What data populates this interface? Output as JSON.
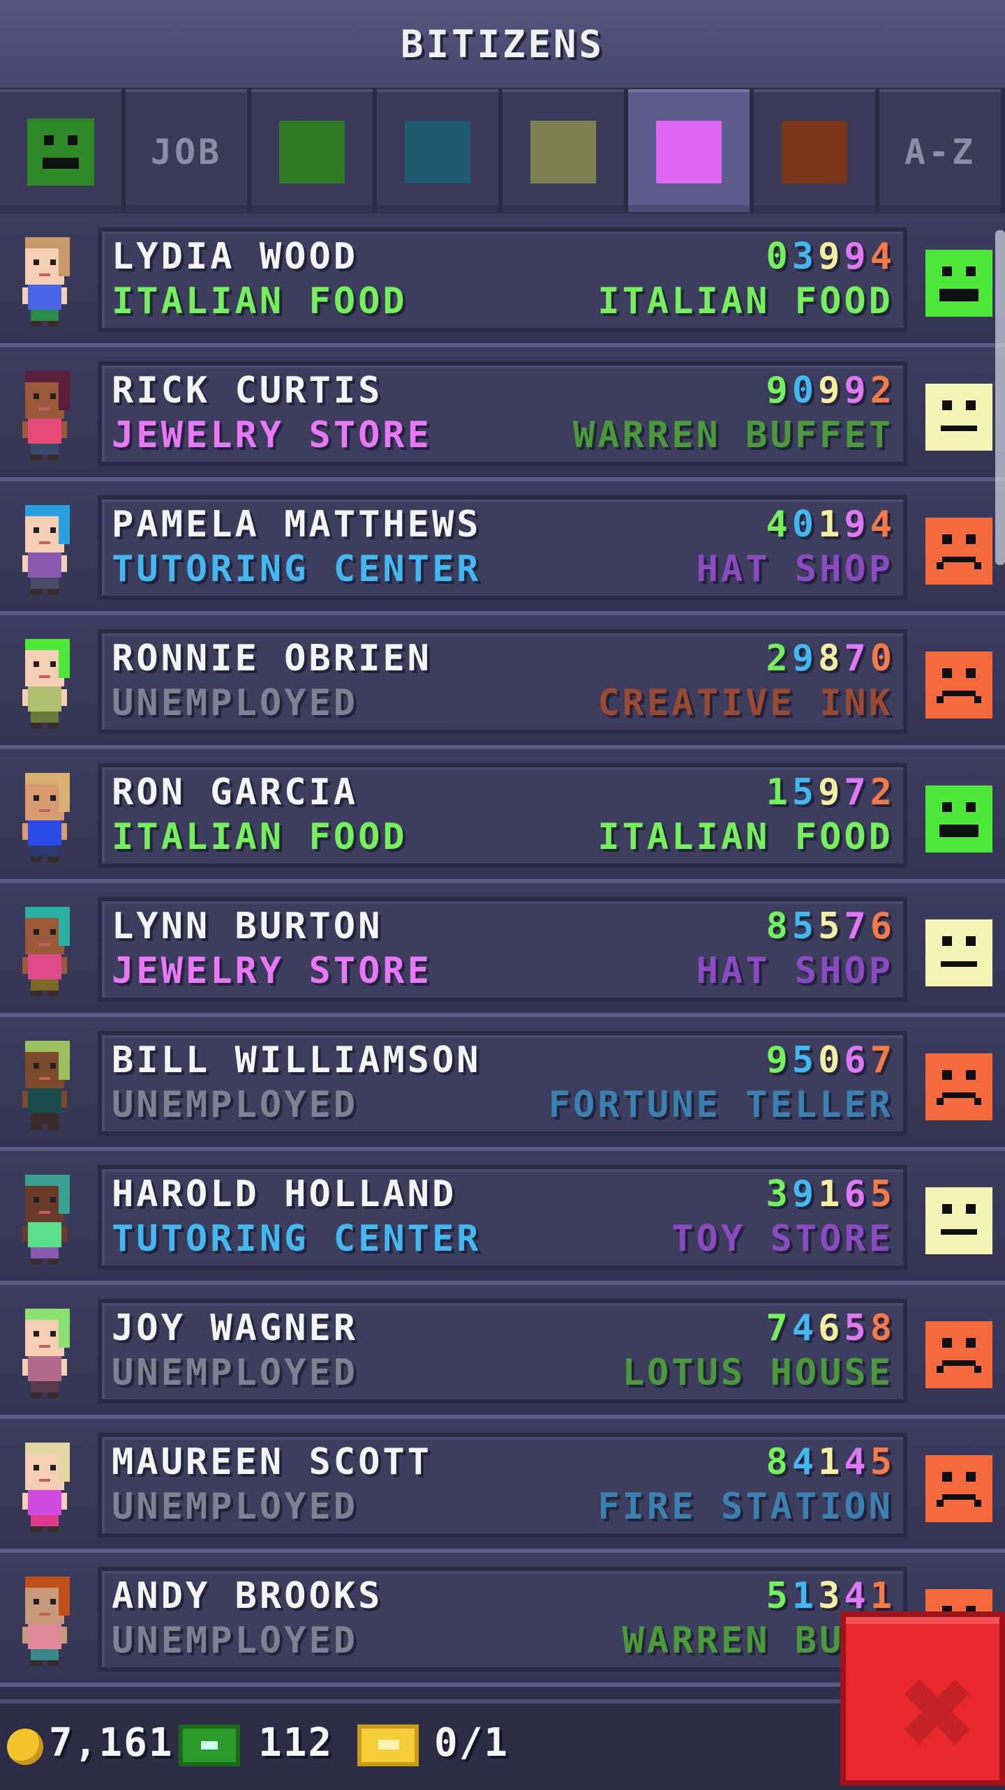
{
  "header": {
    "title": "BITIZENS"
  },
  "tabs": [
    {
      "type": "smiley",
      "color": "#2e8a26",
      "active": false
    },
    {
      "type": "text",
      "label": "JOB",
      "active": false
    },
    {
      "type": "swatch",
      "color": "#2c7a22",
      "active": false
    },
    {
      "type": "swatch",
      "color": "#1f5a70",
      "active": false
    },
    {
      "type": "swatch",
      "color": "#7a8050",
      "active": false
    },
    {
      "type": "swatch",
      "color": "#df66f3",
      "active": true
    },
    {
      "type": "swatch",
      "color": "#7a3618",
      "active": false
    },
    {
      "type": "text",
      "label": "A-Z",
      "active": false
    }
  ],
  "bitizens": [
    {
      "name": "LYDIA WOOD",
      "digits": "03994",
      "job": "ITALIAN FOOD",
      "job_color": "#74f05a",
      "dream": "ITALIAN FOOD",
      "dream_color": "#74f05a",
      "mood": "happy",
      "hair": "#c89a6a",
      "skin": "#f4cfb4",
      "shirt": "#4a64e8",
      "pants": "#2e8a4a"
    },
    {
      "name": "RICK CURTIS",
      "digits": "90992",
      "job": "JEWELRY STORE",
      "job_color": "#e878f6",
      "dream": "WARREN BUFFET",
      "dream_color": "#4a9a3a",
      "mood": "neutral",
      "hair": "#5a1e3a",
      "skin": "#9a5a3a",
      "shirt": "#e84a7a",
      "pants": "#3a4a6a"
    },
    {
      "name": "PAMELA MATTHEWS",
      "digits": "40194",
      "job": "TUTORING CENTER",
      "job_color": "#42b8f0",
      "dream": "HAT SHOP",
      "dream_color": "#8a4ac0",
      "mood": "sad",
      "hair": "#2aa0e0",
      "skin": "#f4cfb4",
      "shirt": "#8a5ab0",
      "pants": "#4a4a6a"
    },
    {
      "name": "RONNIE OBRIEN",
      "digits": "29870",
      "job": "UNEMPLOYED",
      "job_color": "#808090",
      "dream": "CREATIVE INK",
      "dream_color": "#9a4a30",
      "mood": "sad",
      "hair": "#4ee83a",
      "skin": "#f4cfb4",
      "shirt": "#b0c070",
      "pants": "#6a7a3a"
    },
    {
      "name": "RON GARCIA",
      "digits": "15972",
      "job": "ITALIAN FOOD",
      "job_color": "#74f05a",
      "dream": "ITALIAN FOOD",
      "dream_color": "#74f05a",
      "mood": "happy",
      "hair": "#d8b070",
      "skin": "#d89a70",
      "shirt": "#2a4ae8",
      "pants": "#2a3a6a"
    },
    {
      "name": "LYNN BURTON",
      "digits": "85576",
      "job": "JEWELRY STORE",
      "job_color": "#e878f6",
      "dream": "HAT SHOP",
      "dream_color": "#8a4ac0",
      "mood": "neutral",
      "hair": "#2ab0a0",
      "skin": "#9a5a3a",
      "shirt": "#e04a8a",
      "pants": "#7a6a2a"
    },
    {
      "name": "BILL WILLIAMSON",
      "digits": "95067",
      "job": "UNEMPLOYED",
      "job_color": "#808090",
      "dream": "FORTUNE TELLER",
      "dream_color": "#3a80b0",
      "mood": "sad",
      "hair": "#9ac060",
      "skin": "#7a4a2a",
      "shirt": "#1a4a4a",
      "pants": "#3a2a2a"
    },
    {
      "name": "HAROLD HOLLAND",
      "digits": "39165",
      "job": "TUTORING CENTER",
      "job_color": "#42b8f0",
      "dream": "TOY STORE",
      "dream_color": "#8a4ac0",
      "mood": "neutral",
      "hair": "#3aa090",
      "skin": "#6a3a2a",
      "shirt": "#5ae08a",
      "pants": "#8a5ab0"
    },
    {
      "name": "JOY WAGNER",
      "digits": "74658",
      "job": "UNEMPLOYED",
      "job_color": "#808090",
      "dream": "LOTUS HOUSE",
      "dream_color": "#4a9a3a",
      "mood": "sad",
      "hair": "#8ae070",
      "skin": "#f4cfb4",
      "shirt": "#b06a8a",
      "pants": "#5a3a4a"
    },
    {
      "name": "MAUREEN SCOTT",
      "digits": "84145",
      "job": "UNEMPLOYED",
      "job_color": "#808090",
      "dream": "FIRE STATION",
      "dream_color": "#3a80b0",
      "mood": "sad",
      "hair": "#e0d8a0",
      "skin": "#f4cfb4",
      "shirt": "#d04ae0",
      "pants": "#e03a8a"
    },
    {
      "name": "ANDY BROOKS",
      "digits": "51341",
      "job": "UNEMPLOYED",
      "job_color": "#808090",
      "dream": "WARREN BUFF",
      "dream_color": "#4a9a3a",
      "mood": "sad",
      "hair": "#c0501a",
      "skin": "#c89a7a",
      "shirt": "#e08a9a",
      "pants": "#3a8a8a"
    }
  ],
  "footer": {
    "coins": "7,161",
    "bux": "112",
    "tickets": "0/1"
  },
  "close_label": "✖"
}
